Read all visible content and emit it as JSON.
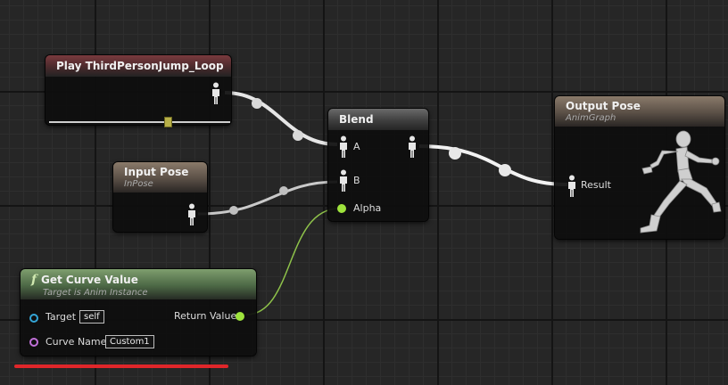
{
  "nodes": {
    "play": {
      "title": "Play ThirdPersonJump_Loop",
      "play_rate": 0.66
    },
    "input_pose": {
      "title": "Input Pose",
      "subtitle": "InPose"
    },
    "blend": {
      "title": "Blend",
      "pin_a": "A",
      "pin_b": "B",
      "pin_alpha": "Alpha"
    },
    "output_pose": {
      "title": "Output Pose",
      "subtitle": "AnimGraph",
      "pin_result": "Result"
    },
    "get_curve": {
      "icon": "f",
      "title": "Get Curve Value",
      "subtitle": "Target is Anim Instance",
      "target_label": "Target",
      "target_value": "self",
      "curve_label": "Curve Name",
      "curve_value": "Custom1",
      "return_label": "Return Value"
    }
  },
  "colors": {
    "exec_wire": "#e6e6e6",
    "float_pin": "#9ee33c",
    "object_pin": "#34a5d6",
    "name_pin": "#c070d8",
    "annotation_underline": "#e0262a"
  }
}
